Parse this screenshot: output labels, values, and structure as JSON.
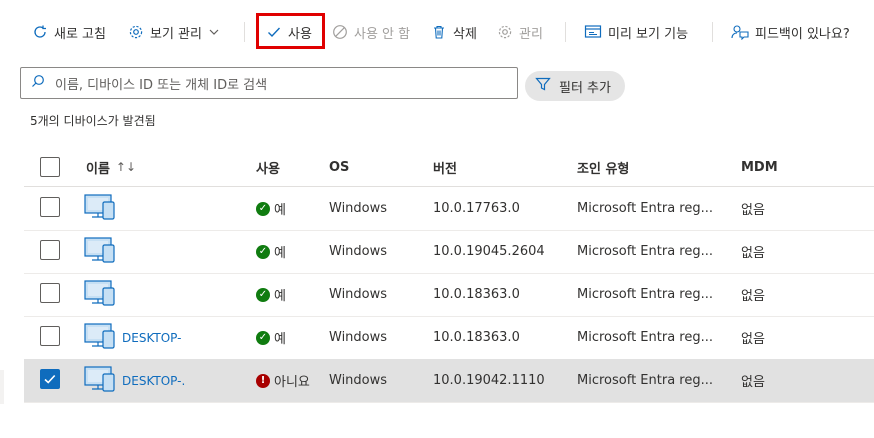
{
  "toolbar": {
    "refresh": "새로 고침",
    "view_manage": "보기 관리",
    "enable": "사용",
    "disable": "사용 안 함",
    "delete": "삭제",
    "manage": "관리",
    "preview": "미리 보기 기능",
    "feedback": "피드백이 있나요?"
  },
  "search": {
    "placeholder": "이름, 디바이스 ID 또는 개체 ID로 검색"
  },
  "filter": {
    "label": "필터 추가"
  },
  "result_count": "5개의 디바이스가 발견됨",
  "columns": {
    "name": "이름",
    "enabled": "사용",
    "os": "OS",
    "version": "버전",
    "join_type": "조인 유형",
    "mdm": "MDM"
  },
  "rows": [
    {
      "name": "",
      "enabled": "예",
      "enabled_ok": true,
      "os": "Windows",
      "version": "10.0.17763.0",
      "join_type": "Microsoft Entra reg...",
      "mdm": "없음",
      "selected": false
    },
    {
      "name": "",
      "enabled": "예",
      "enabled_ok": true,
      "os": "Windows",
      "version": "10.0.19045.2604",
      "join_type": "Microsoft Entra reg...",
      "mdm": "없음",
      "selected": false
    },
    {
      "name": "",
      "enabled": "예",
      "enabled_ok": true,
      "os": "Windows",
      "version": "10.0.18363.0",
      "join_type": "Microsoft Entra reg...",
      "mdm": "없음",
      "selected": false
    },
    {
      "name": "DESKTOP-",
      "enabled": "예",
      "enabled_ok": true,
      "os": "Windows",
      "version": "10.0.18363.0",
      "join_type": "Microsoft Entra reg...",
      "mdm": "없음",
      "selected": false
    },
    {
      "name": "DESKTOP-.",
      "enabled": "아니요",
      "enabled_ok": false,
      "os": "Windows",
      "version": "10.0.19042.1110",
      "join_type": "Microsoft Entra reg...",
      "mdm": "없음",
      "selected": true
    }
  ],
  "colors": {
    "accent": "#0f6cbd",
    "ok": "#107c10",
    "error": "#a80000",
    "highlight": "#e00000"
  }
}
